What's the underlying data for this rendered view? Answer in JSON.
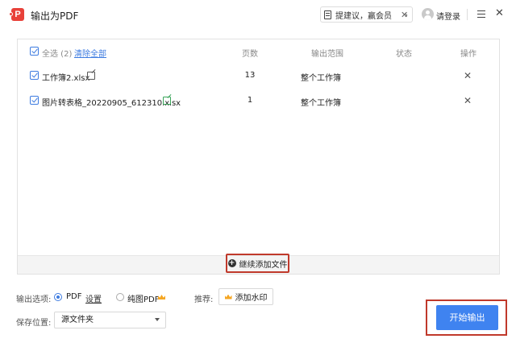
{
  "window": {
    "title": "输出为PDF",
    "suggest_label": "提建议，赢会员",
    "login_label": "请登录"
  },
  "file_list": {
    "select_all_label": "全选 (2)",
    "clear_all_label": "清除全部",
    "columns": {
      "pages": "页数",
      "range": "输出范围",
      "status": "状态",
      "actions": "操作"
    },
    "files": [
      {
        "name": "工作簿2.xlsx",
        "pages": "13",
        "range": "整个工作簿",
        "status": ""
      },
      {
        "name": "图片转表格_20220905_612310.xlsx",
        "pages": "1",
        "range": "整个工作簿",
        "status": ""
      }
    ],
    "add_more_label": "继续添加文件"
  },
  "options": {
    "output_label": "输出选项:",
    "pdf_option": "PDF",
    "settings_link": "设置",
    "image_pdf_option": "纯图PDF",
    "recommend_label": "推荐:",
    "watermark_button": "添加水印",
    "save_location_label": "保存位置:",
    "save_location_value": "源文件夹"
  },
  "actions": {
    "start_button": "开始输出"
  },
  "colors": {
    "accent": "#3f83f0",
    "highlight_outline": "#c0392b",
    "crown": "#f5a623"
  }
}
